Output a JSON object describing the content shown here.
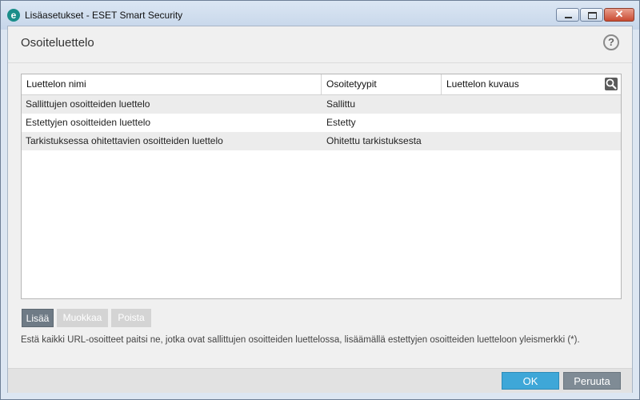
{
  "window": {
    "title": "Lisäasetukset - ESET Smart Security",
    "app_icon_letter": "e",
    "close_glyph": "✕"
  },
  "page": {
    "title": "Osoiteluettelo",
    "help_glyph": "?"
  },
  "table": {
    "columns": [
      "Luettelon nimi",
      "Osoitetyypit",
      "Luettelon kuvaus"
    ],
    "rows": [
      {
        "name": "Sallittujen osoitteiden luettelo",
        "type": "Sallittu",
        "description": ""
      },
      {
        "name": "Estettyjen osoitteiden luettelo",
        "type": "Estetty",
        "description": ""
      },
      {
        "name": "Tarkistuksessa ohitettavien osoitteiden luettelo",
        "type": "Ohitettu tarkistuksesta",
        "description": ""
      }
    ]
  },
  "toolbar": {
    "add_label": "Lisää",
    "edit_label": "Muokkaa",
    "remove_label": "Poista"
  },
  "info_text": "Estä kaikki URL-osoitteet paitsi ne, jotka ovat sallittujen osoitteiden luettelossa, lisäämällä estettyjen osoitteiden luetteloon yleismerkki (*).",
  "footer": {
    "ok_label": "OK",
    "cancel_label": "Peruuta"
  },
  "colors": {
    "ok_button": "#3ea7d8",
    "cancel_button": "#7f8b95",
    "add_button": "#6f7b86",
    "disabled_button": "#d4d4d4",
    "accent_logo": "#1a8e8a"
  }
}
